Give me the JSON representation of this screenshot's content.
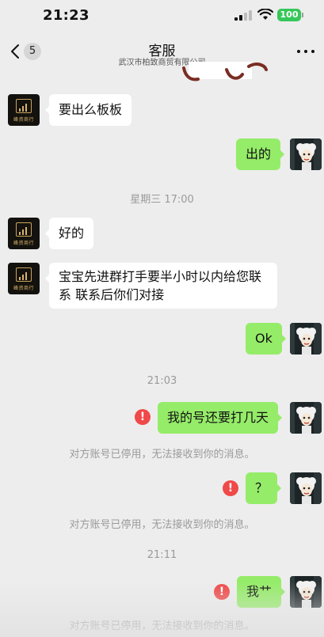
{
  "status_bar": {
    "time": "21:23",
    "battery": "100",
    "battery_color": "#35c759"
  },
  "header": {
    "back_icon": "chevron-left-icon",
    "unread_count": "5",
    "title": "客服",
    "subtitle": "武汉市柏致商贸有限公司",
    "more_icon": "more-dots-icon"
  },
  "shop_avatar_text": "峰资商行",
  "colors": {
    "incoming_bubble": "#ffffff",
    "outgoing_bubble": "#95ec69",
    "error": "#f04949",
    "background": "#ededed"
  },
  "messages": [
    {
      "from": "shop",
      "text": "要出么板板"
    },
    {
      "from": "me",
      "text": "出的"
    },
    {
      "type": "time",
      "text": "星期三 17:00"
    },
    {
      "from": "shop",
      "text": "好的"
    },
    {
      "from": "shop",
      "text": "宝宝先进群打手要半小时以内给您联系 联系后你们对接"
    },
    {
      "from": "me",
      "text": "Ok"
    },
    {
      "type": "time",
      "text": "21:03"
    },
    {
      "from": "me",
      "text": "我的号还要打几天",
      "failed": true
    },
    {
      "type": "notice",
      "text": "对方账号已停用，无法接收到你的消息。"
    },
    {
      "from": "me",
      "text": "？",
      "failed": true
    },
    {
      "type": "notice",
      "text": "对方账号已停用，无法接收到你的消息。"
    },
    {
      "type": "time",
      "text": "21:11"
    },
    {
      "from": "me",
      "text": "我艹",
      "failed": true
    },
    {
      "type": "notice",
      "text": "对方账号已停用，无法接收到你的消息。"
    }
  ]
}
